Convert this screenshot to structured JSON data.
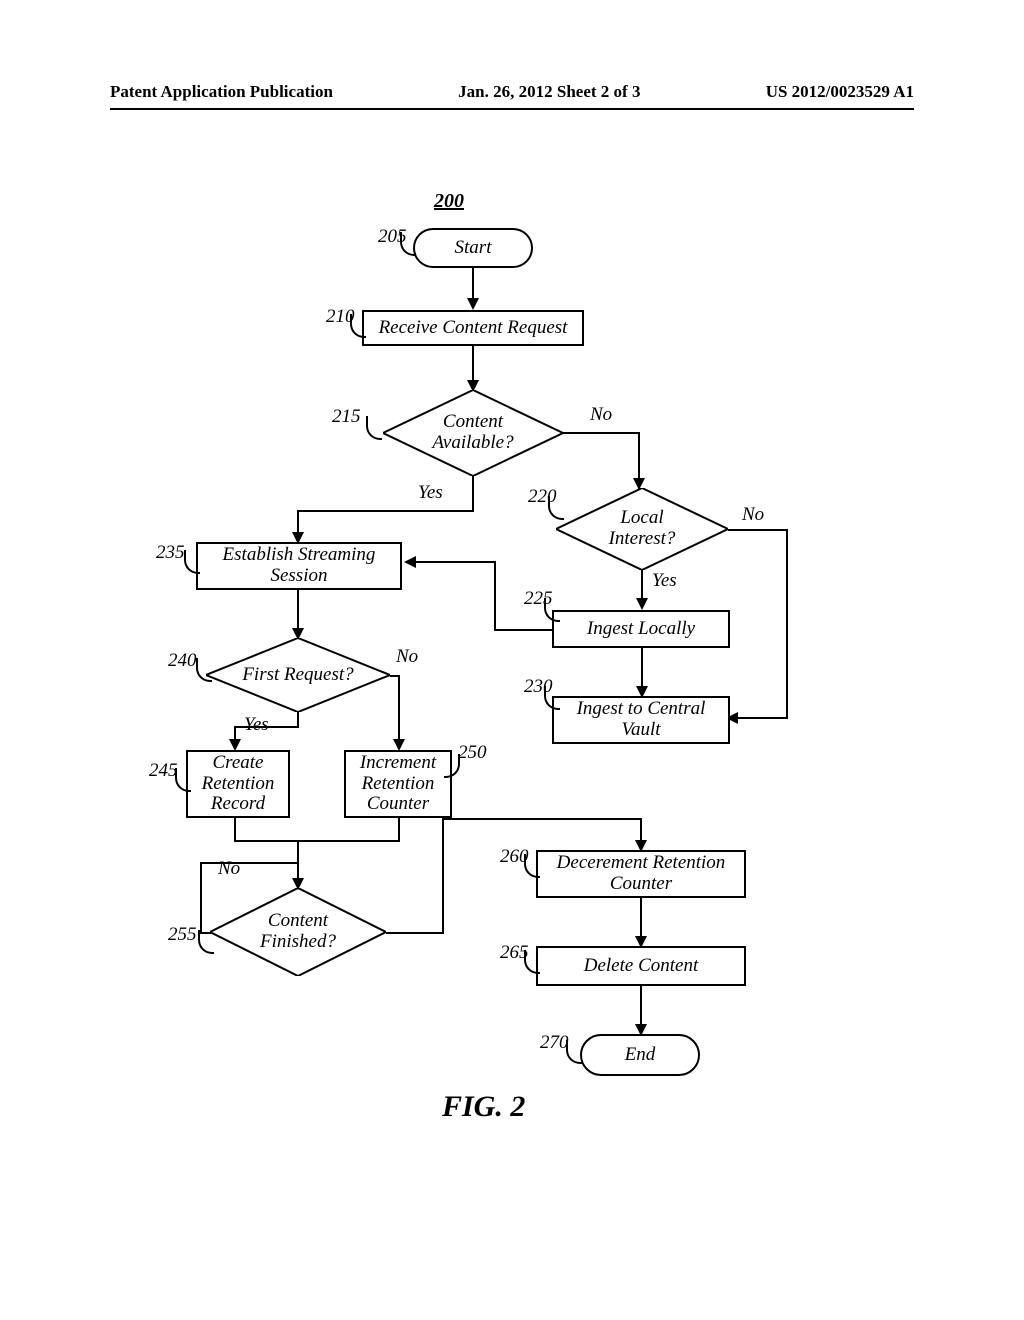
{
  "header": {
    "left": "Patent Application Publication",
    "center": "Jan. 26, 2012  Sheet 2 of 3",
    "right": "US 2012/0023529 A1"
  },
  "figure": {
    "ref": "200",
    "title": "FIG. 2"
  },
  "nodes": {
    "start": {
      "ref": "205",
      "text": "Start"
    },
    "receive": {
      "ref": "210",
      "text": "Receive Content Request"
    },
    "available": {
      "ref": "215",
      "text": "Content\nAvailable?"
    },
    "localInterest": {
      "ref": "220",
      "text": "Local\nInterest?"
    },
    "ingestLocal": {
      "ref": "225",
      "text": "Ingest Locally"
    },
    "ingestCentral": {
      "ref": "230",
      "text": "Ingest to Central\nVault"
    },
    "establish": {
      "ref": "235",
      "text": "Establish Streaming\nSession"
    },
    "firstReq": {
      "ref": "240",
      "text": "First Request?"
    },
    "createRec": {
      "ref": "245",
      "text": "Create\nRetention\nRecord"
    },
    "incRec": {
      "ref": "250",
      "text": "Increment\nRetention\nCounter"
    },
    "finished": {
      "ref": "255",
      "text": "Content\nFinished?"
    },
    "decrement": {
      "ref": "260",
      "text": "Decerement Retention\nCounter"
    },
    "delete": {
      "ref": "265",
      "text": "Delete Content"
    },
    "end": {
      "ref": "270",
      "text": "End"
    }
  },
  "edges": {
    "yes": "Yes",
    "no": "No"
  }
}
